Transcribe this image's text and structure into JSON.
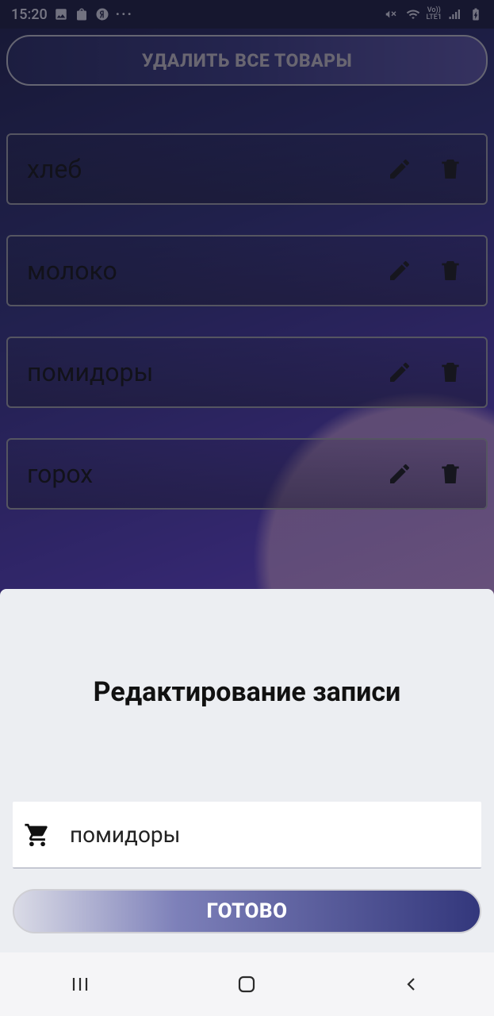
{
  "statusbar": {
    "time": "15:20",
    "network_label": "LTE1",
    "volte_label": "Vo))"
  },
  "header": {
    "delete_all_label": "УДАЛИТЬ ВСЕ ТОВАРЫ"
  },
  "items": [
    {
      "name": "хлеб"
    },
    {
      "name": "молоко"
    },
    {
      "name": "помидоры"
    },
    {
      "name": "горох"
    }
  ],
  "sheet": {
    "title": "Редактирование записи",
    "input_value": "помидоры",
    "done_label": "ГОТОВО"
  }
}
